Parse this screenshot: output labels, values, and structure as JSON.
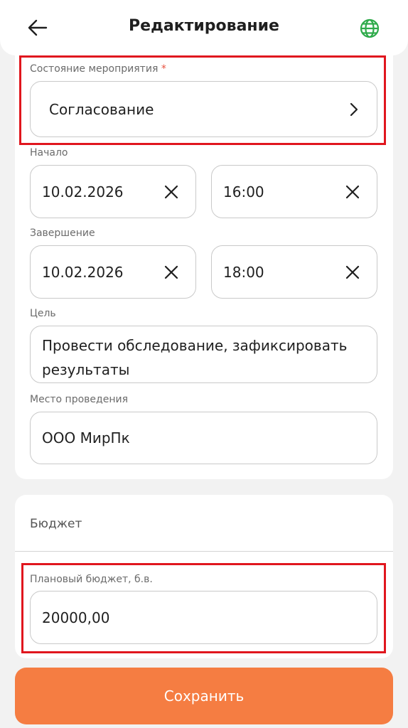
{
  "header": {
    "title": "Редактирование",
    "back_icon": "arrow-left-icon",
    "language_icon": "globe-icon"
  },
  "event_state": {
    "label": "Состояние мероприятия",
    "required_mark": "*",
    "value": "Согласование"
  },
  "start": {
    "label": "Начало",
    "date": "10.02.2026",
    "time": "16:00"
  },
  "end": {
    "label": "Завершение",
    "date": "10.02.2026",
    "time": "18:00"
  },
  "goal": {
    "label": "Цель",
    "value": "Провести обследование, зафиксировать результаты"
  },
  "venue": {
    "label": "Место проведения",
    "value": "ООО МирПк"
  },
  "budget": {
    "section_title": "Бюджет",
    "planned_label": "Плановый бюджет, б.в.",
    "planned_value": "20000,00"
  },
  "actions": {
    "save_label": "Сохранить"
  },
  "colors": {
    "accent": "#f57d42",
    "highlight": "#e0161e",
    "globe": "#2eaa4a",
    "required": "#e8513f"
  }
}
